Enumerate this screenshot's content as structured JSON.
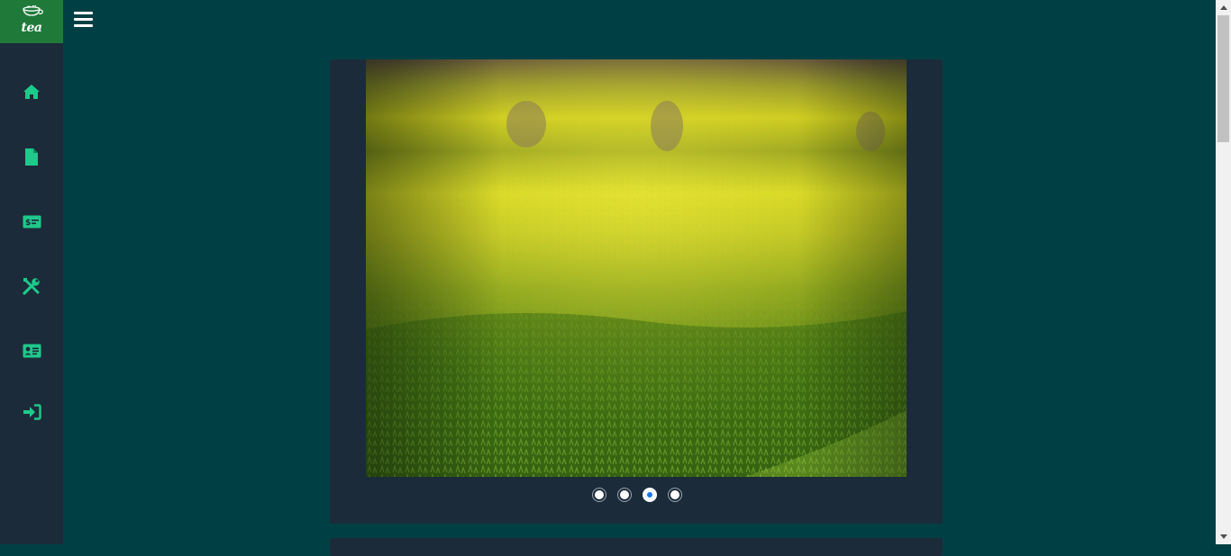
{
  "logo": {
    "text": "tea"
  },
  "sidebar": {
    "items": [
      {
        "icon": "home-icon"
      },
      {
        "icon": "file-icon"
      },
      {
        "icon": "money-card-icon"
      },
      {
        "icon": "tools-icon"
      },
      {
        "icon": "id-card-icon"
      },
      {
        "icon": "sign-in-icon"
      }
    ]
  },
  "carousel": {
    "slide_count": 4,
    "active_index": 2
  },
  "colors": {
    "background": "#004045",
    "sidebar": "#1b2b3a",
    "logo_bg": "#1f7a3a",
    "icon": "#1ec98a",
    "card": "#1b2b3a",
    "active_dot": "#1a73e8"
  }
}
